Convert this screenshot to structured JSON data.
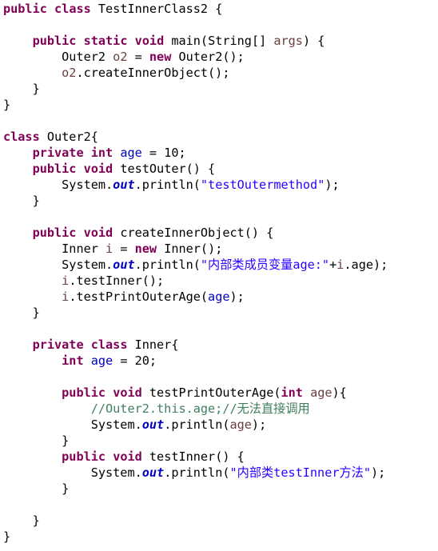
{
  "editor": {
    "language": "java",
    "colors": {
      "background": "#ffffff",
      "keyword": "#7f0055",
      "string": "#2a00ff",
      "field": "#0000c0",
      "comment": "#3f7f5f",
      "local_variable": "#6a3e3e",
      "default": "#000000"
    },
    "lines": [
      {
        "indent": "",
        "tokens": [
          {
            "text": "public",
            "type": "kw"
          },
          {
            "text": " "
          },
          {
            "text": "class",
            "type": "kw"
          },
          {
            "text": " TestInnerClass2 {"
          }
        ]
      },
      {
        "indent": "",
        "tokens": []
      },
      {
        "indent": "    ",
        "tokens": [
          {
            "text": "public",
            "type": "kw"
          },
          {
            "text": " "
          },
          {
            "text": "static",
            "type": "kw"
          },
          {
            "text": " "
          },
          {
            "text": "void",
            "type": "kw"
          },
          {
            "text": " main(String[] "
          },
          {
            "text": "args",
            "type": "var"
          },
          {
            "text": ") {"
          }
        ]
      },
      {
        "indent": "        ",
        "tokens": [
          {
            "text": "Outer2 "
          },
          {
            "text": "o2",
            "type": "var"
          },
          {
            "text": " = "
          },
          {
            "text": "new",
            "type": "kw"
          },
          {
            "text": " Outer2();"
          }
        ]
      },
      {
        "indent": "        ",
        "tokens": [
          {
            "text": "o2",
            "type": "var"
          },
          {
            "text": ".createInnerObject();"
          }
        ]
      },
      {
        "indent": "    ",
        "tokens": [
          {
            "text": "}"
          }
        ]
      },
      {
        "indent": "",
        "tokens": [
          {
            "text": "}"
          }
        ]
      },
      {
        "indent": "",
        "tokens": []
      },
      {
        "indent": "",
        "tokens": [
          {
            "text": "class",
            "type": "kw"
          },
          {
            "text": " Outer2{"
          }
        ]
      },
      {
        "indent": "    ",
        "tokens": [
          {
            "text": "private",
            "type": "kw"
          },
          {
            "text": " "
          },
          {
            "text": "int",
            "type": "kw"
          },
          {
            "text": " "
          },
          {
            "text": "age",
            "type": "fld"
          },
          {
            "text": " = 10;"
          }
        ]
      },
      {
        "indent": "    ",
        "tokens": [
          {
            "text": "public",
            "type": "kw"
          },
          {
            "text": " "
          },
          {
            "text": "void",
            "type": "kw"
          },
          {
            "text": " testOuter() {"
          }
        ]
      },
      {
        "indent": "        ",
        "tokens": [
          {
            "text": "System."
          },
          {
            "text": "out",
            "type": "sfld"
          },
          {
            "text": ".println("
          },
          {
            "text": "\"testOutermethod\"",
            "type": "str"
          },
          {
            "text": ");"
          }
        ]
      },
      {
        "indent": "    ",
        "tokens": [
          {
            "text": "}"
          }
        ]
      },
      {
        "indent": "",
        "tokens": []
      },
      {
        "indent": "    ",
        "tokens": [
          {
            "text": "public",
            "type": "kw"
          },
          {
            "text": " "
          },
          {
            "text": "void",
            "type": "kw"
          },
          {
            "text": " createInnerObject() {"
          }
        ]
      },
      {
        "indent": "        ",
        "tokens": [
          {
            "text": "Inner "
          },
          {
            "text": "i",
            "type": "var"
          },
          {
            "text": " = "
          },
          {
            "text": "new",
            "type": "kw"
          },
          {
            "text": " Inner();"
          }
        ]
      },
      {
        "indent": "        ",
        "tokens": [
          {
            "text": "System."
          },
          {
            "text": "out",
            "type": "sfld"
          },
          {
            "text": ".println("
          },
          {
            "text": "\"内部类成员变量age:\"",
            "type": "str"
          },
          {
            "text": "+"
          },
          {
            "text": "i",
            "type": "var"
          },
          {
            "text": ".age);"
          }
        ]
      },
      {
        "indent": "        ",
        "tokens": [
          {
            "text": "i",
            "type": "var"
          },
          {
            "text": ".testInner();"
          }
        ]
      },
      {
        "indent": "        ",
        "tokens": [
          {
            "text": "i",
            "type": "var"
          },
          {
            "text": ".testPrintOuterAge("
          },
          {
            "text": "age",
            "type": "fld"
          },
          {
            "text": ");"
          }
        ]
      },
      {
        "indent": "    ",
        "tokens": [
          {
            "text": "}"
          }
        ]
      },
      {
        "indent": "",
        "tokens": []
      },
      {
        "indent": "    ",
        "tokens": [
          {
            "text": "private",
            "type": "kw"
          },
          {
            "text": " "
          },
          {
            "text": "class",
            "type": "kw"
          },
          {
            "text": " Inner{"
          }
        ]
      },
      {
        "indent": "        ",
        "tokens": [
          {
            "text": "int",
            "type": "kw"
          },
          {
            "text": " "
          },
          {
            "text": "age",
            "type": "fld"
          },
          {
            "text": " = 20;"
          }
        ]
      },
      {
        "indent": "",
        "tokens": []
      },
      {
        "indent": "        ",
        "tokens": [
          {
            "text": "public",
            "type": "kw"
          },
          {
            "text": " "
          },
          {
            "text": "void",
            "type": "kw"
          },
          {
            "text": " testPrintOuterAge("
          },
          {
            "text": "int",
            "type": "kw"
          },
          {
            "text": " "
          },
          {
            "text": "age",
            "type": "var"
          },
          {
            "text": "){"
          }
        ]
      },
      {
        "indent": "            ",
        "tokens": [
          {
            "text": "//Outer2.this.age;//无法直接调用",
            "type": "cmt"
          }
        ]
      },
      {
        "indent": "            ",
        "tokens": [
          {
            "text": "System."
          },
          {
            "text": "out",
            "type": "sfld"
          },
          {
            "text": ".println("
          },
          {
            "text": "age",
            "type": "var"
          },
          {
            "text": ");"
          }
        ]
      },
      {
        "indent": "        ",
        "tokens": [
          {
            "text": "}"
          }
        ]
      },
      {
        "indent": "        ",
        "tokens": [
          {
            "text": "public",
            "type": "kw"
          },
          {
            "text": " "
          },
          {
            "text": "void",
            "type": "kw"
          },
          {
            "text": " testInner() {"
          }
        ]
      },
      {
        "indent": "            ",
        "tokens": [
          {
            "text": "System."
          },
          {
            "text": "out",
            "type": "sfld"
          },
          {
            "text": ".println("
          },
          {
            "text": "\"内部类testInner方法\"",
            "type": "str"
          },
          {
            "text": ");"
          }
        ]
      },
      {
        "indent": "        ",
        "tokens": [
          {
            "text": "}"
          }
        ]
      },
      {
        "indent": "",
        "tokens": []
      },
      {
        "indent": "    ",
        "tokens": [
          {
            "text": "}"
          }
        ]
      },
      {
        "indent": "",
        "tokens": [
          {
            "text": "}"
          }
        ]
      }
    ]
  }
}
